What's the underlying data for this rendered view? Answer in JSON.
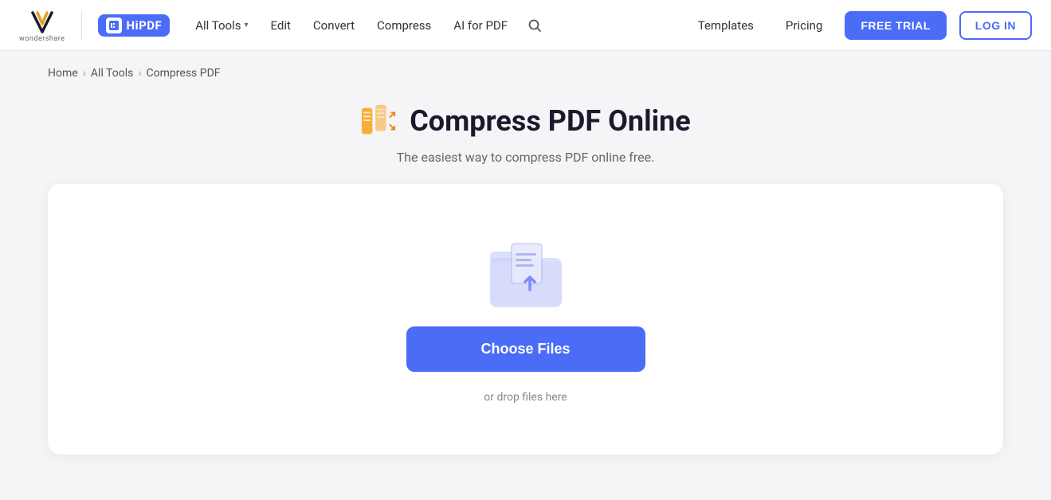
{
  "navbar": {
    "logo_alt": "Wondershare",
    "hipdf_label": "HiPDF",
    "nav_items": [
      {
        "label": "All Tools",
        "has_dropdown": true
      },
      {
        "label": "Edit",
        "has_dropdown": false
      },
      {
        "label": "Convert",
        "has_dropdown": false
      },
      {
        "label": "Compress",
        "has_dropdown": false
      },
      {
        "label": "AI for PDF",
        "has_dropdown": false
      }
    ],
    "right_items": [
      {
        "label": "Templates"
      },
      {
        "label": "Pricing"
      }
    ],
    "free_trial_label": "FREE TRIAL",
    "login_label": "LOG IN"
  },
  "breadcrumb": {
    "items": [
      "Home",
      "All Tools",
      "Compress PDF"
    ]
  },
  "hero": {
    "title": "Compress PDF Online",
    "subtitle": "The easiest way to compress PDF online free."
  },
  "dropzone": {
    "choose_files_label": "Choose Files",
    "drop_hint": "or drop files here"
  }
}
